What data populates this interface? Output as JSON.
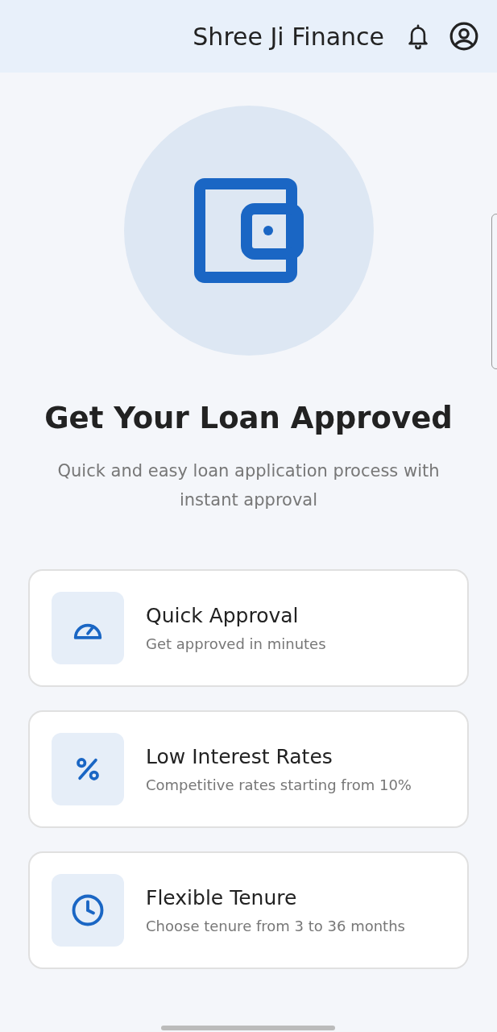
{
  "header": {
    "title": "Shree Ji Finance"
  },
  "hero": {
    "title": "Get Your Loan Approved",
    "subtitle": "Quick and easy loan application process with instant approval"
  },
  "features": [
    {
      "kind": "speed",
      "title": "Quick Approval",
      "subtitle": "Get approved in minutes"
    },
    {
      "kind": "percent",
      "title": "Low Interest Rates",
      "subtitle": "Competitive rates starting from 10%"
    },
    {
      "kind": "clock",
      "title": "Flexible Tenure",
      "subtitle": "Choose tenure from 3 to 36 months"
    }
  ]
}
